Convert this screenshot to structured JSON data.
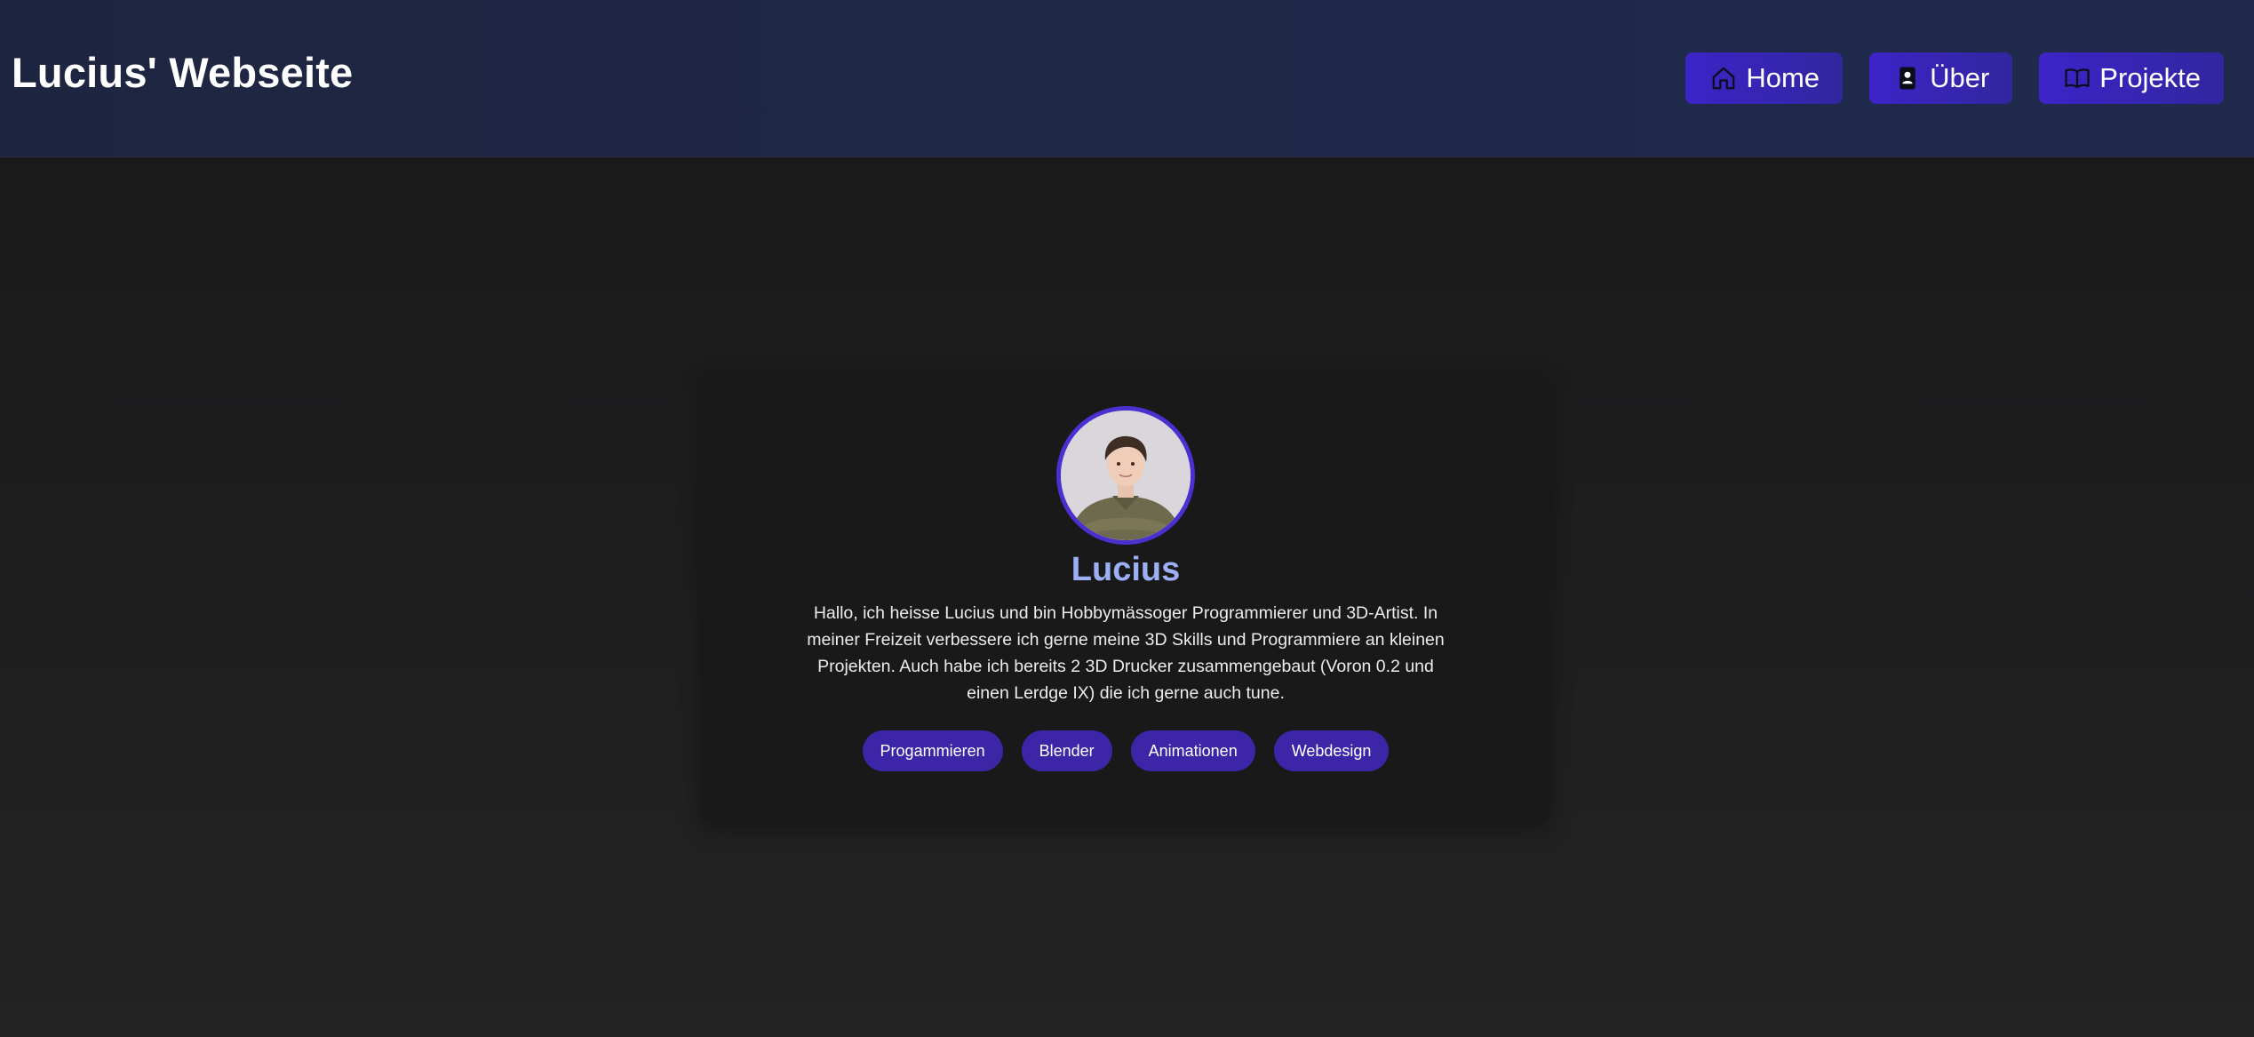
{
  "header": {
    "title": "Lucius' Webseite",
    "nav": [
      {
        "label": "Home",
        "icon": "home-icon"
      },
      {
        "label": "Über",
        "icon": "contact-card-icon"
      },
      {
        "label": "Projekte",
        "icon": "book-icon"
      }
    ]
  },
  "profile": {
    "name": "Lucius",
    "bio": "Hallo, ich heisse Lucius und bin Hobbymässoger Programmierer und 3D-Artist. In meiner Freizeit verbessere ich gerne meine 3D Skills und Programmiere an kleinen Projekten. Auch habe ich bereits 2 3D Drucker zusammengebaut (Voron 0.2 und einen Lerdge IX) die ich gerne auch tune.",
    "tags": [
      "Progammieren",
      "Blender",
      "Animationen",
      "Webdesign"
    ]
  },
  "colors": {
    "header_bg": "#1f2847",
    "page_bg": "#1f1f21",
    "card_bg": "#19191a",
    "accent": "#3c24c8",
    "name_color": "#9db0f5"
  }
}
